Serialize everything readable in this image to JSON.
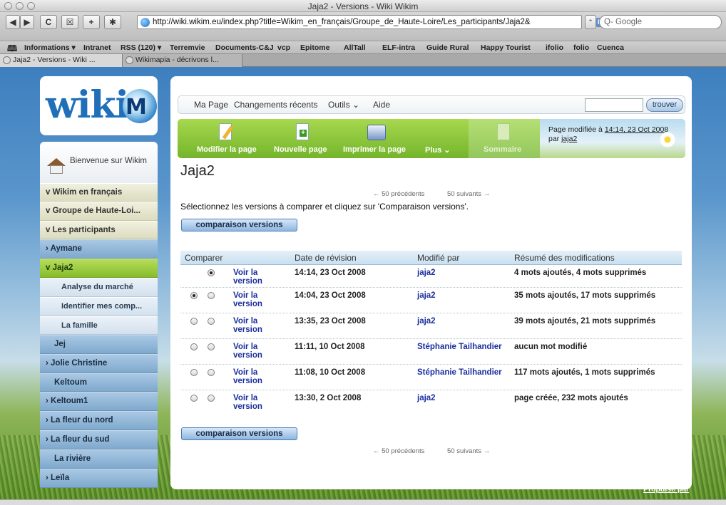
{
  "window": {
    "title": "Jaja2 - Versions - Wiki Wikim"
  },
  "toolbar": {
    "back": "◀",
    "forward": "▶",
    "reload": "C",
    "add": "+",
    "url": "http://wiki.wikim.eu/index.php?title=Wikim_en_français/Groupe_de_Haute-Loire/Les_participants/Jaja2&",
    "rss": "RSS",
    "search_placeholder": "Q- Google"
  },
  "bookmarks": [
    "Informations ▾",
    "Intranet",
    "RSS (120) ▾",
    "Terremvie",
    "Documents-C&J",
    "vcp",
    "Epitome",
    "AllTall",
    "ELF-intra",
    "Guide Rural",
    "Happy Tourist",
    "ifolio",
    "folio",
    "Cuenca"
  ],
  "tabs": [
    {
      "label": "Jaja2 - Versions - Wiki ..."
    },
    {
      "label": "Wikimapia - décrivons l..."
    }
  ],
  "logo": {
    "text": "wiki",
    "m": "M"
  },
  "sidebar": {
    "welcome": "Bienvenue sur Wikim",
    "items": [
      {
        "label": "v Wikim en français"
      },
      {
        "label": "v Groupe de Haute-Loi..."
      },
      {
        "label": "v Les participants"
      },
      {
        "label": "› Aymane"
      },
      {
        "label": "v Jaja2"
      },
      {
        "label": "Analyse du marché"
      },
      {
        "label": "Identifier mes comp..."
      },
      {
        "label": "La famille"
      },
      {
        "label": "Jej"
      },
      {
        "label": "› Jolie Christine"
      },
      {
        "label": "Keltoum"
      },
      {
        "label": "› Keltoum1"
      },
      {
        "label": "› La fleur du nord"
      },
      {
        "label": "› La fleur du sud"
      },
      {
        "label": "La rivière"
      },
      {
        "label": "› Leïla"
      }
    ]
  },
  "topnav": {
    "ma_page": "Ma Page",
    "changements": "Changements récents",
    "outils": "Outils ⌄",
    "aide": "Aide",
    "search_button": "trouver"
  },
  "actions": {
    "modifier": "Modifier la page",
    "nouvelle": "Nouvelle page",
    "imprimer": "Imprimer la page",
    "plus": "Plus ⌄",
    "sommaire": "Sommaire"
  },
  "modified": {
    "line1": "Page modifiée à ",
    "date_link": "14:14, 23 Oct 2008",
    "line2": "par ",
    "user_link": "jaja2"
  },
  "page": {
    "title": "Jaja2",
    "prev": "← 50 précédents",
    "next": "50 suivants →",
    "instructions": "Sélectionnez les versions à comparer et cliquez sur 'Comparaison versions'.",
    "compare_button": "comparaison versions"
  },
  "table": {
    "headers": [
      "Comparer",
      "Date de révision",
      "Modifié par",
      "Résumé des modifications"
    ],
    "rows": [
      {
        "voir": "Voir la version",
        "date": "14:14, 23 Oct 2008",
        "user": "jaja2",
        "summary": "4 mots ajoutés, 4 mots supprimés"
      },
      {
        "voir": "Voir la version",
        "date": "14:04, 23 Oct 2008",
        "user": "jaja2",
        "summary": "35 mots ajoutés, 17 mots supprimés"
      },
      {
        "voir": "Voir la version",
        "date": "13:35, 23 Oct 2008",
        "user": "jaja2",
        "summary": "39 mots ajoutés, 21 mots supprimés"
      },
      {
        "voir": "Voir la version",
        "date": "11:11, 10 Oct 2008",
        "user": "Stéphanie Tailhandier",
        "summary": "aucun mot modifié"
      },
      {
        "voir": "Voir la version",
        "date": "11:08, 10 Oct 2008",
        "user": "Stéphanie Tailhandier",
        "summary": "117 mots ajoutés, 1 mots supprimés"
      },
      {
        "voir": "Voir la version",
        "date": "13:30, 2 Oct 2008",
        "user": "jaja2",
        "summary": "page créée, 232 mots ajoutés"
      }
    ]
  },
  "footer": {
    "propulse": "Propulsé par"
  }
}
